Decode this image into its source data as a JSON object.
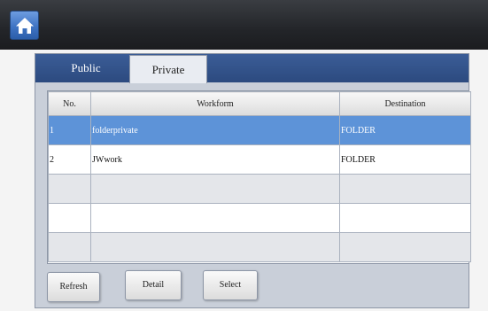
{
  "header": {
    "home_icon": "home-icon"
  },
  "tabs": [
    {
      "label": "Public",
      "active": false
    },
    {
      "label": "Private",
      "active": true
    }
  ],
  "table": {
    "columns": [
      "No.",
      "Workform",
      "Destination"
    ],
    "rows": [
      {
        "no": "1",
        "workform": "folderprivate",
        "destination": "FOLDER",
        "selected": true
      },
      {
        "no": "2",
        "workform": "JWwork",
        "destination": "FOLDER",
        "selected": false
      },
      {
        "no": "",
        "workform": "",
        "destination": "",
        "selected": false
      },
      {
        "no": "",
        "workform": "",
        "destination": "",
        "selected": false
      },
      {
        "no": "",
        "workform": "",
        "destination": "",
        "selected": false
      }
    ]
  },
  "buttons": {
    "refresh": "Refresh",
    "detail": "Detail",
    "select": "Select"
  },
  "colors": {
    "selected_row": "#5d93d8",
    "tab_bar": "#2c4a7f",
    "home_button": "#3f74c4"
  }
}
